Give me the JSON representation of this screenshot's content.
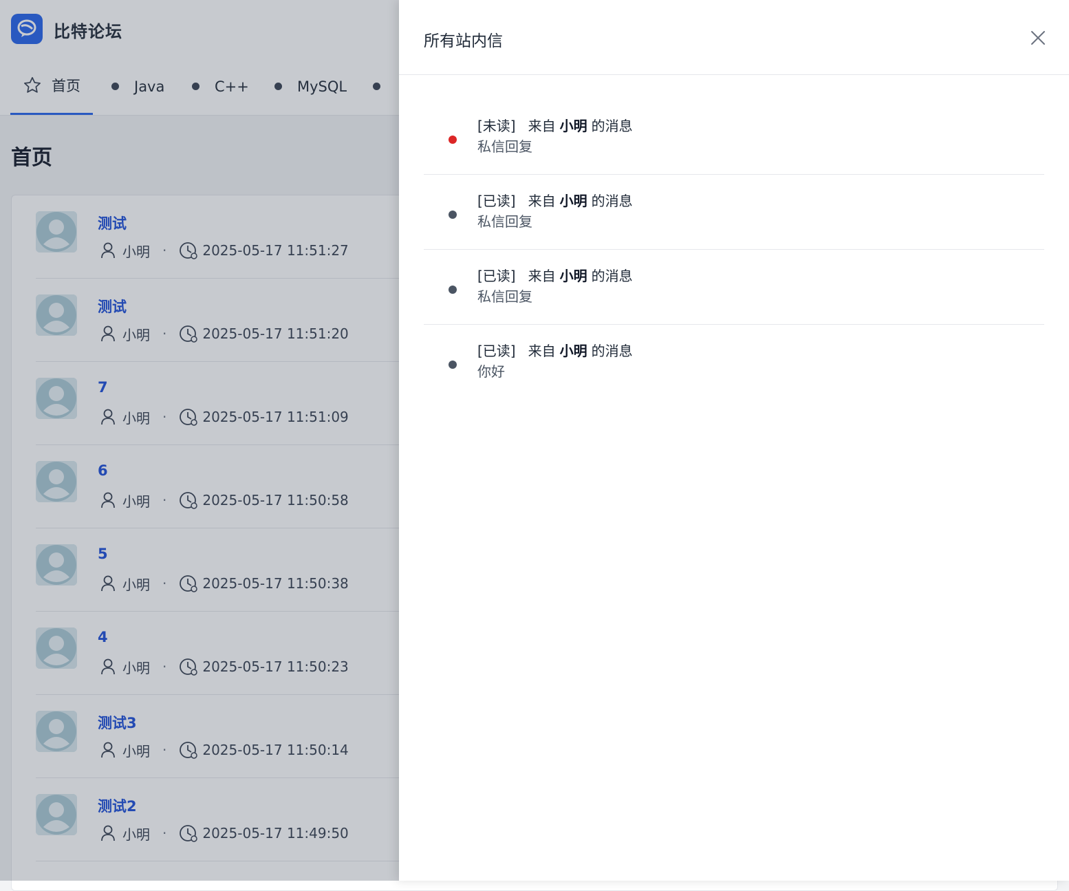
{
  "site": {
    "name": "比特论坛",
    "logo_icon": "chat-bubble-icon",
    "brand_color": "#2563eb"
  },
  "nav": {
    "items": [
      {
        "label": "首页",
        "icon": "star-icon",
        "active": true
      },
      {
        "label": "Java",
        "icon": "dot"
      },
      {
        "label": "C++",
        "icon": "dot"
      },
      {
        "label": "MySQL",
        "icon": "dot"
      }
    ]
  },
  "page": {
    "title": "首页"
  },
  "threads": [
    {
      "title": "测试",
      "author": "小明",
      "time": "2025-05-17 11:51:27"
    },
    {
      "title": "测试",
      "author": "小明",
      "time": "2025-05-17 11:51:20"
    },
    {
      "title": "7",
      "author": "小明",
      "time": "2025-05-17 11:51:09"
    },
    {
      "title": "6",
      "author": "小明",
      "time": "2025-05-17 11:50:58"
    },
    {
      "title": "5",
      "author": "小明",
      "time": "2025-05-17 11:50:38"
    },
    {
      "title": "4",
      "author": "小明",
      "time": "2025-05-17 11:50:23"
    },
    {
      "title": "测试3",
      "author": "小明",
      "time": "2025-05-17 11:50:14"
    },
    {
      "title": "测试2",
      "author": "小明",
      "time": "2025-05-17 11:49:50"
    }
  ],
  "meta": {
    "separator": "·"
  },
  "drawer": {
    "title": "所有站内信",
    "close_icon": "close-icon",
    "messages": [
      {
        "status": "[未读]",
        "prefix": "来自",
        "sender": "小明",
        "suffix": "的消息",
        "content": "私信回复",
        "dot_color": "#dc2626"
      },
      {
        "status": "[已读]",
        "prefix": "来自",
        "sender": "小明",
        "suffix": "的消息",
        "content": "私信回复",
        "dot_color": "#4b5563"
      },
      {
        "status": "[已读]",
        "prefix": "来自",
        "sender": "小明",
        "suffix": "的消息",
        "content": "私信回复",
        "dot_color": "#4b5563"
      },
      {
        "status": "[已读]",
        "prefix": "来自",
        "sender": "小明",
        "suffix": "的消息",
        "content": "你好",
        "dot_color": "#4b5563"
      }
    ]
  }
}
